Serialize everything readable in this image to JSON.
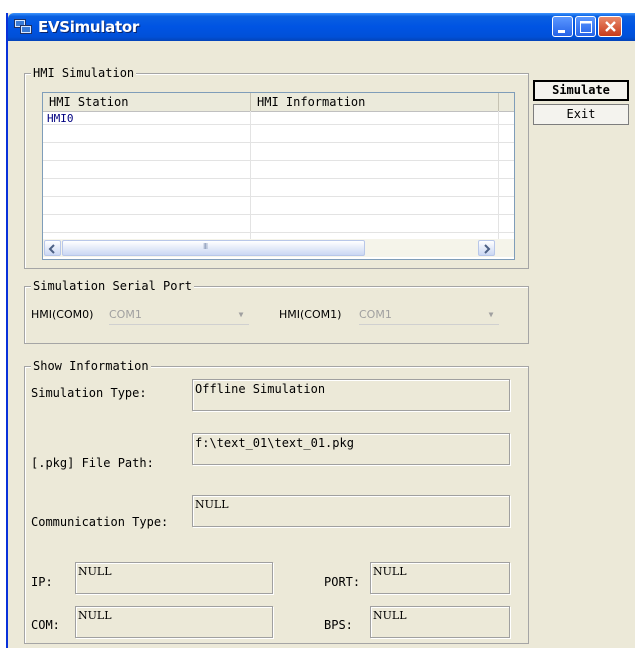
{
  "window": {
    "title": "EVSimulator"
  },
  "hmi_simulation": {
    "group_label": "HMI Simulation",
    "columns": [
      "HMI Station",
      "HMI Information"
    ],
    "rows": [
      [
        "HMI0",
        ""
      ],
      [
        "",
        ""
      ],
      [
        "",
        ""
      ],
      [
        "",
        ""
      ],
      [
        "",
        ""
      ],
      [
        "",
        ""
      ],
      [
        "",
        ""
      ]
    ],
    "scroll_thumb_glyph": "III"
  },
  "serial_port": {
    "group_label": "Simulation Serial Port",
    "com0_label": "HMI(COM0)",
    "com0_value": "COM1",
    "com1_label": "HMI(COM1)",
    "com1_value": "COM1"
  },
  "show_info": {
    "group_label": "Show Information",
    "sim_type_label": "Simulation Type:",
    "sim_type_value": "Offline Simulation",
    "pkg_path_label": "[.pkg] File Path:",
    "pkg_path_value": "f:\\text_01\\text_01.pkg",
    "comm_type_label": "Communication Type:",
    "comm_type_value": "NULL",
    "ip_label": "IP:",
    "ip_value": "NULL",
    "port_label": "PORT:",
    "port_value": "NULL",
    "com_label": "COM:",
    "com_value": "NULL",
    "bps_label": "BPS:",
    "bps_value": "NULL"
  },
  "buttons": {
    "simulate": "Simulate",
    "exit": "Exit"
  },
  "colors": {
    "titlebar": "#0054e3",
    "hmi_row_text": "#000080",
    "dialog_bg": "#ece9d8"
  }
}
